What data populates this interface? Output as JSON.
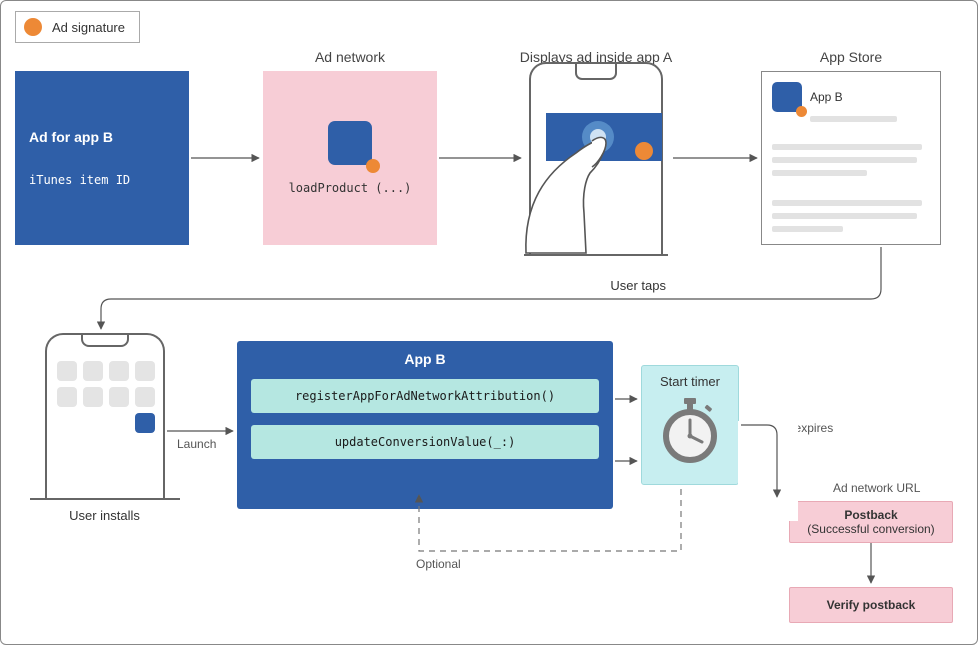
{
  "legend": {
    "label": "Ad signature"
  },
  "headings": {
    "ad_network": "Ad network",
    "displays_ad": "Displays ad inside app A",
    "app_store": "App Store"
  },
  "ad_box": {
    "title": "Ad for app B",
    "sub": "iTunes item ID"
  },
  "network": {
    "code": "loadProduct (...)"
  },
  "phone_ad": {
    "caption": "User taps"
  },
  "store": {
    "app_label": "App B"
  },
  "phone_install": {
    "caption": "User installs",
    "launch_label": "Launch"
  },
  "appb": {
    "title": "App B",
    "api1": "registerAppForAdNetworkAttribution()",
    "api2": "updateConversionValue(_:)",
    "optional_label": "Optional"
  },
  "timer": {
    "title": "Start timer",
    "expires_label": "Timer expires"
  },
  "ad_network_url": "Ad network URL",
  "postback": {
    "title": "Postback",
    "sub": "(Successful conversion)"
  },
  "verify": {
    "title": "Verify postback"
  }
}
